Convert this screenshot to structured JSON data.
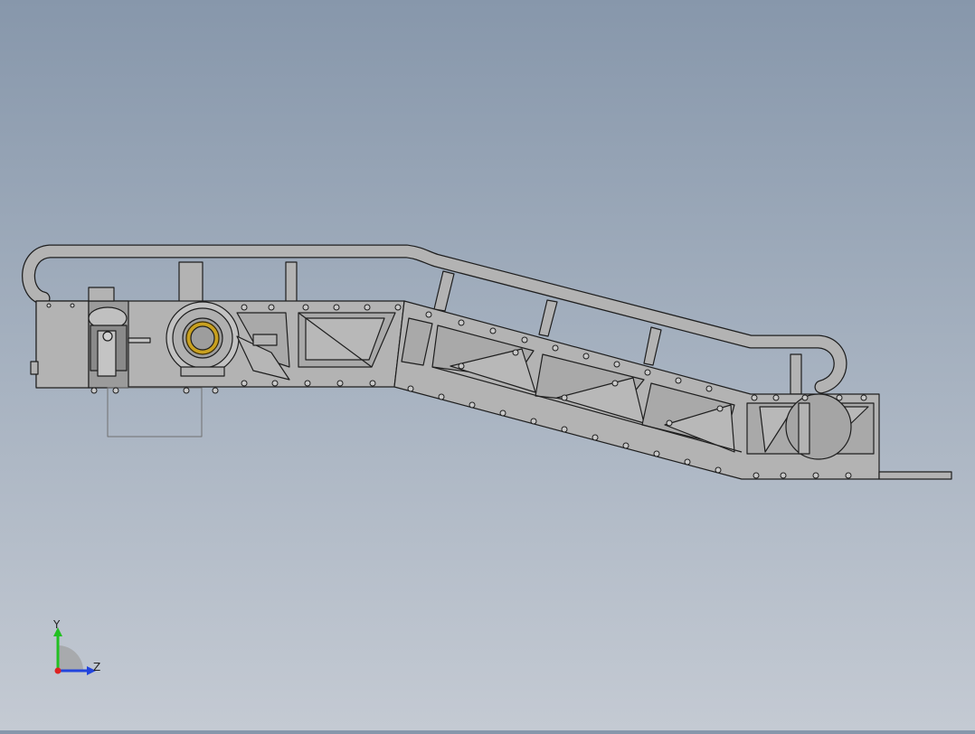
{
  "viewport": {
    "background_top": "#8797ab",
    "background_bottom": "#c4cad3",
    "model_fill": "#b2b2b2",
    "model_stroke": "#202020",
    "bearing_color": "#c8a020"
  },
  "triad": {
    "y_label": "Y",
    "z_label": "Z",
    "y_color": "#22c022",
    "z_color": "#2244dd",
    "x_color": "#dd2222"
  }
}
